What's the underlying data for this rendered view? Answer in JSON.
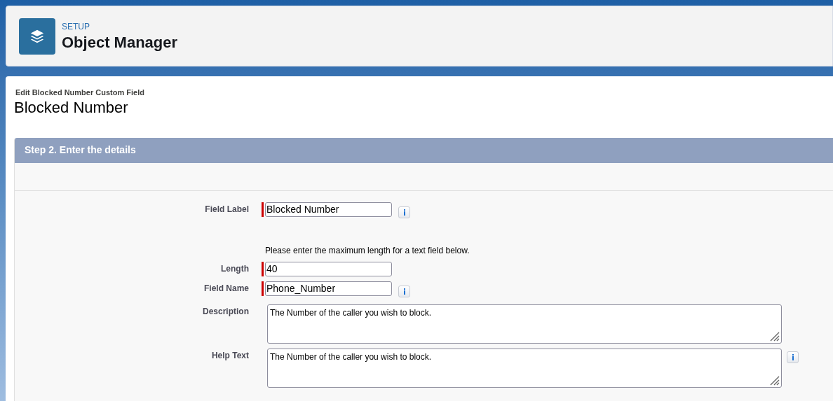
{
  "header": {
    "eyebrow": "SETUP",
    "title": "Object Manager"
  },
  "page": {
    "subtitle": "Edit Blocked Number Custom Field",
    "title": "Blocked Number"
  },
  "section": {
    "title": "Step 2. Enter the details"
  },
  "fields": [
    {
      "kind": "input",
      "label": "Field Label",
      "value": "Blocked Number",
      "required": true,
      "info": true
    },
    {
      "kind": "note",
      "text": "Please enter the maximum length for a text field below."
    },
    {
      "kind": "input",
      "label": "Length",
      "value": "40",
      "required": true,
      "info": false
    },
    {
      "kind": "input",
      "label": "Field Name",
      "value": "Phone_Number",
      "required": true,
      "info": true
    },
    {
      "kind": "textarea",
      "label": "Description",
      "value": "The Number of the caller you wish to block.",
      "required": false,
      "info": false
    },
    {
      "kind": "textarea",
      "label": "Help Text",
      "value": "The Number of the caller you wish to block.",
      "required": false,
      "info": true
    }
  ]
}
